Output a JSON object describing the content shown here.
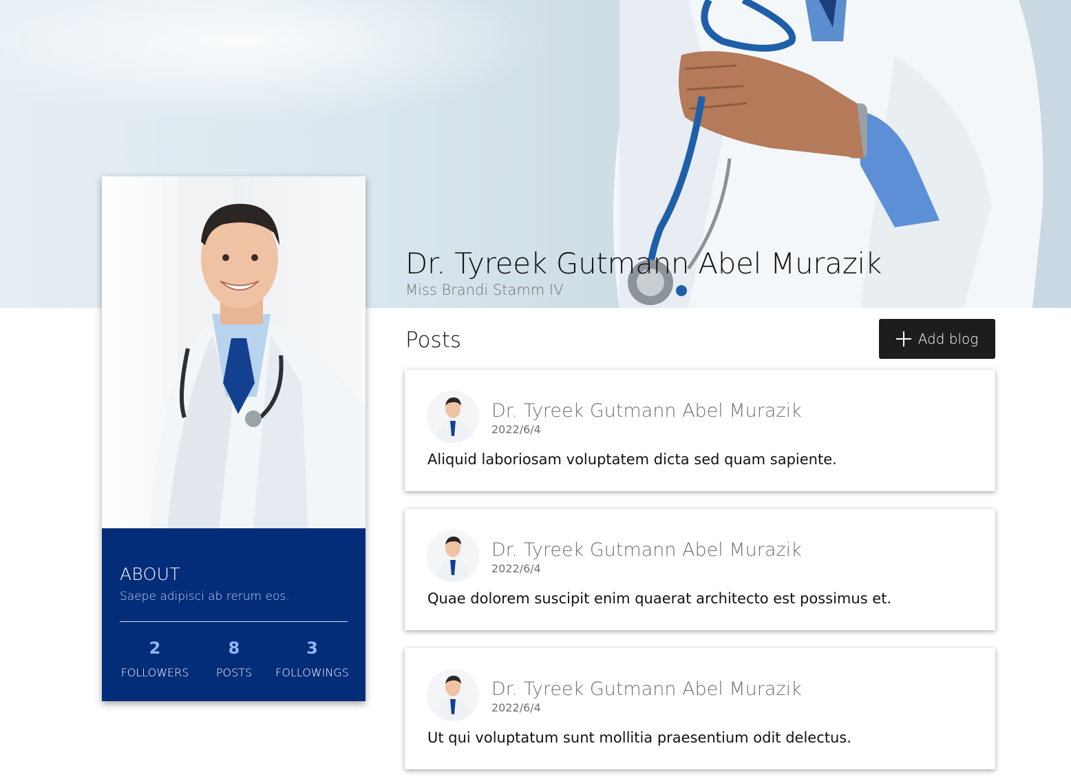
{
  "profile": {
    "name": "Dr. Tyreek Gutmann Abel Murazik",
    "subtitle": "Miss Brandi Stamm IV"
  },
  "about": {
    "title": "ABOUT",
    "text": "Saepe adipisci ab rerum eos.",
    "stats": [
      {
        "value": "2",
        "label": "FOLLOWERS"
      },
      {
        "value": "8",
        "label": "POSTS"
      },
      {
        "value": "3",
        "label": "FOLLOWINGS"
      }
    ]
  },
  "posts": {
    "heading": "Posts",
    "add_label": "Add blog",
    "items": [
      {
        "author": "Dr. Tyreek Gutmann Abel Murazik",
        "date": "2022/6/4",
        "body": "Aliquid laboriosam voluptatem dicta sed quam sapiente."
      },
      {
        "author": "Dr. Tyreek Gutmann Abel Murazik",
        "date": "2022/6/4",
        "body": "Quae dolorem suscipit enim quaerat architecto est possimus et."
      },
      {
        "author": "Dr. Tyreek Gutmann Abel Murazik",
        "date": "2022/6/4",
        "body": "Ut qui voluptatum sunt mollitia praesentium odit delectus."
      }
    ]
  },
  "colors": {
    "about_bg": "#032c79",
    "stat_value": "#8fb7f2",
    "button_bg": "#1d1d1d"
  },
  "icons": {
    "add": "plus-icon"
  }
}
